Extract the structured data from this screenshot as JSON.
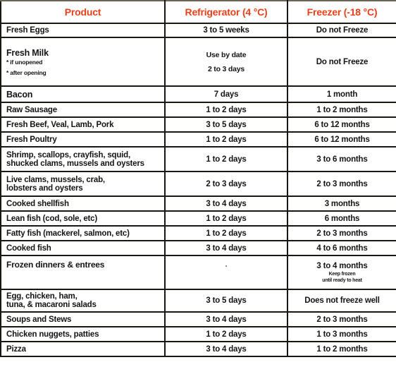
{
  "header": {
    "product": "Product",
    "refrigerator": "Refrigerator (4 °C)",
    "freezer": "Freezer (-18 °C)"
  },
  "colors": {
    "header_text": "#e8401a",
    "border": "#1a1712",
    "body_text": "#141414"
  },
  "rows": [
    {
      "product": "Fresh Eggs",
      "refrigerator": "3 to 5 weeks",
      "freezer": "Do not Freeze"
    },
    {
      "product": "Fresh Milk",
      "notes": [
        "* if unopened",
        "* after opening"
      ],
      "refrigerator_lines": [
        "Use by date",
        "2 to 3 days"
      ],
      "freezer": "Do not Freeze"
    },
    {
      "product": "Bacon",
      "refrigerator": "7 days",
      "freezer": "1 month"
    },
    {
      "product": "Raw Sausage",
      "refrigerator": "1 to 2 days",
      "freezer": "1 to 2 months"
    },
    {
      "product": "Fresh Beef, Veal, Lamb, Pork",
      "refrigerator": "3 to 5 days",
      "freezer": "6 to 12 months"
    },
    {
      "product": "Fresh Poultry",
      "refrigerator": "1 to 2 days",
      "freezer": "6 to 12 months"
    },
    {
      "product_lines": [
        "Shrimp, scallops, crayfish, squid,",
        "shucked clams, mussels and oysters"
      ],
      "refrigerator": "1 to 2 days",
      "freezer": "3 to 6 months"
    },
    {
      "product_lines": [
        "Live clams, mussels, crab,",
        "lobsters and oysters"
      ],
      "refrigerator": "2 to 3 days",
      "freezer": "2 to 3 months"
    },
    {
      "product": "Cooked shellfish",
      "refrigerator": "3 to 4 days",
      "freezer": "3 months"
    },
    {
      "product": "Lean fish (cod, sole, etc)",
      "refrigerator": "1 to 2 days",
      "freezer": "6 months"
    },
    {
      "product": "Fatty fish (mackerel, salmon, etc)",
      "refrigerator": "1 to 2 days",
      "freezer": "2 to 3 months"
    },
    {
      "product": "Cooked fish",
      "refrigerator": "3 to 4 days",
      "freezer": "4 to 6 months"
    },
    {
      "product": "Frozen dinners & entrees",
      "refrigerator": "-",
      "freezer": "3 to 4 months",
      "freezer_note_lines": [
        "Keep frozen",
        "until ready to heat"
      ]
    },
    {
      "product_lines": [
        "Egg, chicken, ham,",
        "tuna, & macaroni salads"
      ],
      "refrigerator": "3 to 5 days",
      "freezer": "Does not freeze well"
    },
    {
      "product": "Soups and Stews",
      "refrigerator": "3 to 4 days",
      "freezer": "2 to 3 months"
    },
    {
      "product": "Chicken nuggets, patties",
      "refrigerator": "1 to 2 days",
      "freezer": "1 to 3 months"
    },
    {
      "product": "Pizza",
      "refrigerator": "3 to 4 days",
      "freezer": "1 to 2 months"
    }
  ]
}
